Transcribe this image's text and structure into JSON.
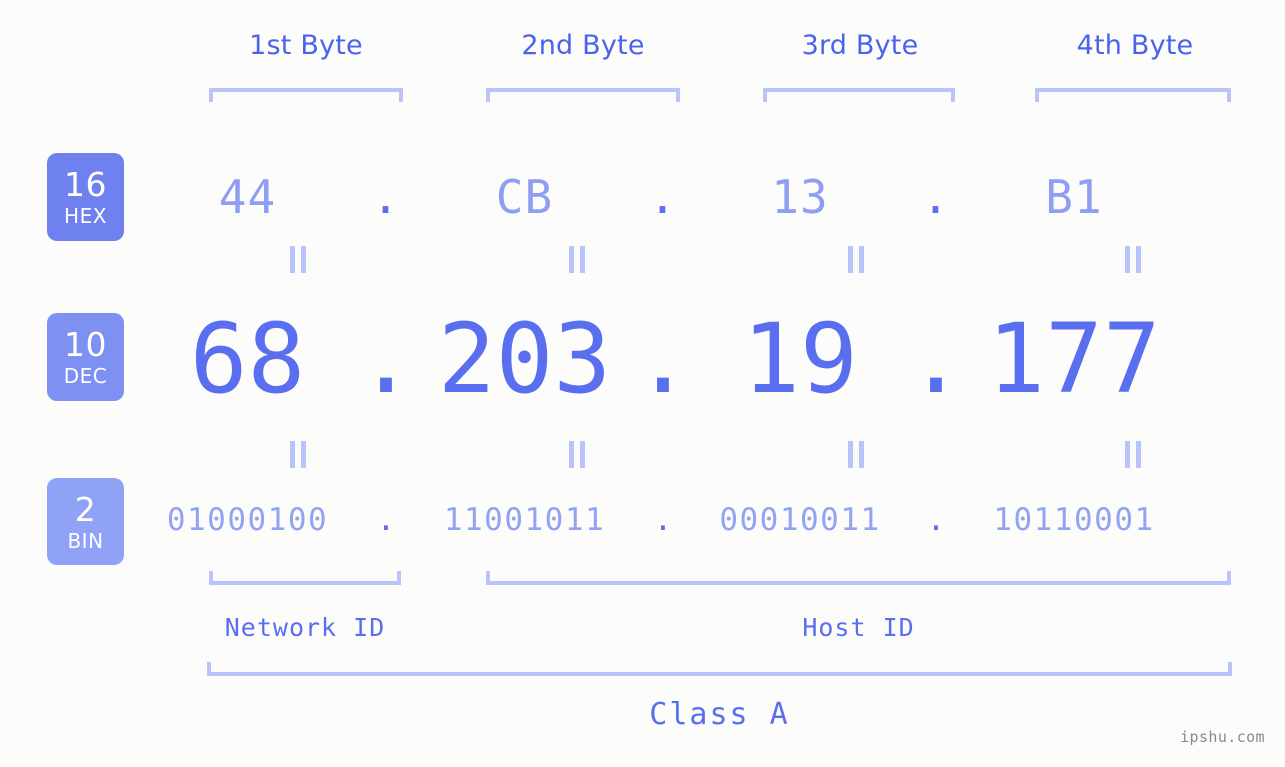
{
  "meta": {
    "background_color": "#fcfdfa",
    "accent_strong": "#5a6ff0",
    "accent_mid": "#8f9ef2",
    "accent_light": "#b9c4fb",
    "watermark_color": "#8a8a8a"
  },
  "byte_headers": [
    {
      "label": "1st Byte"
    },
    {
      "label": "2nd Byte"
    },
    {
      "label": "3rd Byte"
    },
    {
      "label": "4th Byte"
    }
  ],
  "bases": [
    {
      "number": "16",
      "unit": "HEX",
      "color": "#6f81ef"
    },
    {
      "number": "10",
      "unit": "DEC",
      "color": "#7e90f2"
    },
    {
      "number": "2",
      "unit": "BIN",
      "color": "#8fa2f5"
    }
  ],
  "rows": {
    "hex": {
      "label": "HEX",
      "values": [
        "44",
        "CB",
        "13",
        "B1"
      ],
      "separator": "."
    },
    "dec": {
      "label": "DEC",
      "values": [
        "68",
        "203",
        "19",
        "177"
      ],
      "separator": "."
    },
    "bin": {
      "label": "BIN",
      "values": [
        "01000100",
        "11001011",
        "00010011",
        "10110001"
      ],
      "separator": "."
    }
  },
  "equals_symbol": "=",
  "sections": [
    {
      "label": "Network ID"
    },
    {
      "label": "Host ID"
    }
  ],
  "class": {
    "label": "Class A"
  },
  "watermark": {
    "text": "ipshu.com"
  }
}
